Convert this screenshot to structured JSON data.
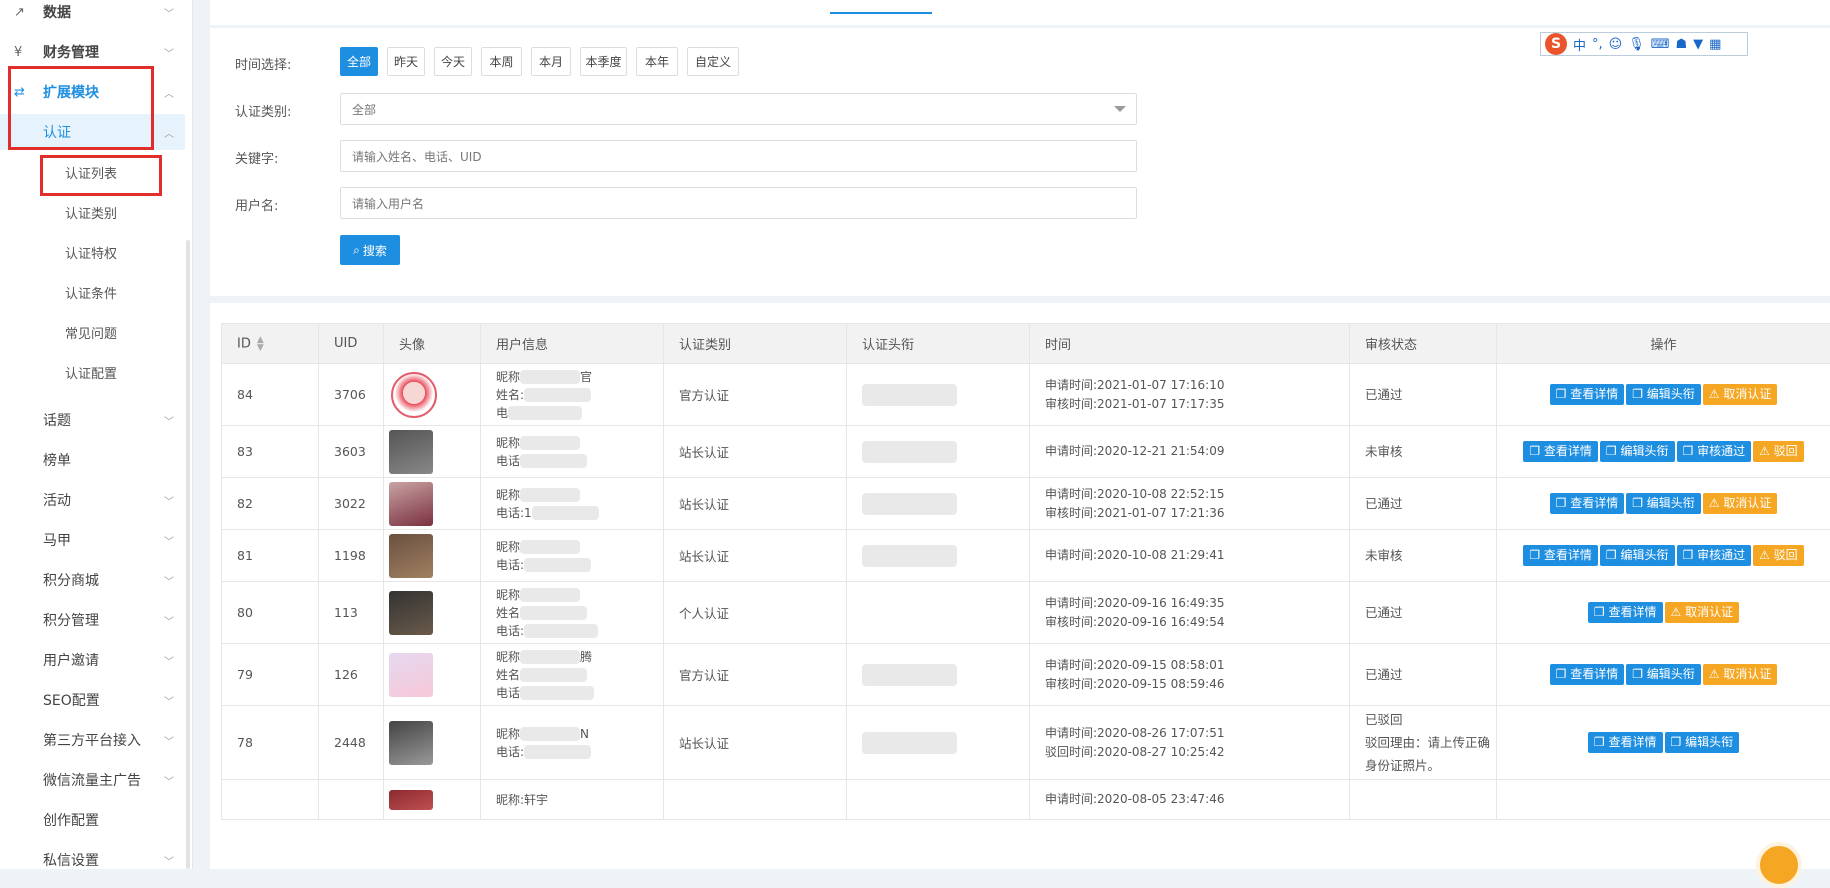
{
  "sidebar": {
    "items": [
      {
        "label": "数据",
        "icon": "line-chart-icon",
        "kind": "top-lvl",
        "chevron": true
      },
      {
        "label": "财务管理",
        "icon": "finance-icon",
        "kind": "top-lvl",
        "chevron": true
      },
      {
        "label": "扩展模块",
        "icon": "extend-icon",
        "kind": "top-lvl active",
        "chevron": true
      },
      {
        "label": "认证",
        "kind": "sub selected",
        "chevron": true
      },
      {
        "label": "认证列表",
        "kind": "leaf"
      },
      {
        "label": "认证类别",
        "kind": "leaf"
      },
      {
        "label": "认证特权",
        "kind": "leaf"
      },
      {
        "label": "认证条件",
        "kind": "leaf"
      },
      {
        "label": "常见问题",
        "kind": "leaf"
      },
      {
        "label": "认证配置",
        "kind": "leaf"
      },
      {
        "label": "话题",
        "kind": "plain",
        "chevron": true
      },
      {
        "label": "榜单",
        "kind": "plain"
      },
      {
        "label": "活动",
        "kind": "plain",
        "chevron": true
      },
      {
        "label": "马甲",
        "kind": "plain",
        "chevron": true
      },
      {
        "label": "积分商城",
        "kind": "plain",
        "chevron": true
      },
      {
        "label": "积分管理",
        "kind": "plain",
        "chevron": true
      },
      {
        "label": "用户邀请",
        "kind": "plain",
        "chevron": true
      },
      {
        "label": "SEO配置",
        "kind": "plain",
        "chevron": true
      },
      {
        "label": "第三方平台接入",
        "kind": "plain",
        "chevron": true
      },
      {
        "label": "微信流量主广告",
        "kind": "plain",
        "chevron": true
      },
      {
        "label": "创作配置",
        "kind": "plain"
      },
      {
        "label": "私信设置",
        "kind": "plain",
        "chevron": true
      }
    ]
  },
  "filters": {
    "time_label": "时间选择:",
    "time_buttons": [
      "全部",
      "昨天",
      "今天",
      "本周",
      "本月",
      "本季度",
      "本年",
      "自定义"
    ],
    "type_label": "认证类别:",
    "type_value": "全部",
    "keyword_label": "关键字:",
    "keyword_placeholder": "请输入姓名、电话、UID",
    "username_label": "用户名:",
    "username_placeholder": "请输入用户名",
    "search_label": "搜索"
  },
  "ime": {
    "logo": "S",
    "lang": "中",
    "symbols": "°,"
  },
  "table": {
    "headers": [
      "ID",
      "UID",
      "头像",
      "用户信息",
      "认证类别",
      "认证头衔",
      "时间",
      "审核状态",
      "操作"
    ],
    "rows": [
      {
        "id": "84",
        "uid": "3706",
        "info": [
          "昵称",
          "姓名:",
          "电"
        ],
        "info_tail": "官",
        "type": "官方认证",
        "times": [
          "申请时间:2021-01-07 17:16:10",
          "审核时间:2021-01-07 17:17:35"
        ],
        "status": [
          "已通过"
        ],
        "ops": [
          "查看详情",
          "编辑头衔",
          "取消认证"
        ]
      },
      {
        "id": "83",
        "uid": "3603",
        "info": [
          "昵称",
          "电话"
        ],
        "type": "站长认证",
        "times": [
          "申请时间:2020-12-21 21:54:09"
        ],
        "status": [
          "未审核"
        ],
        "ops": [
          "查看详情",
          "编辑头衔",
          "审核通过",
          "驳回"
        ]
      },
      {
        "id": "82",
        "uid": "3022",
        "info": [
          "昵称",
          "电话:1"
        ],
        "type": "站长认证",
        "times": [
          "申请时间:2020-10-08 22:52:15",
          "审核时间:2021-01-07 17:21:36"
        ],
        "status": [
          "已通过"
        ],
        "ops": [
          "查看详情",
          "编辑头衔",
          "取消认证"
        ]
      },
      {
        "id": "81",
        "uid": "1198",
        "info": [
          "昵称",
          "电话:"
        ],
        "type": "站长认证",
        "times": [
          "申请时间:2020-10-08 21:29:41"
        ],
        "status": [
          "未审核"
        ],
        "ops": [
          "查看详情",
          "编辑头衔",
          "审核通过",
          "驳回"
        ]
      },
      {
        "id": "80",
        "uid": "113",
        "info": [
          "昵称",
          "姓名",
          "电话:"
        ],
        "type": "个人认证",
        "times": [
          "申请时间:2020-09-16 16:49:35",
          "审核时间:2020-09-16 16:49:54"
        ],
        "status": [
          "已通过"
        ],
        "ops": [
          "查看详情",
          "取消认证"
        ]
      },
      {
        "id": "79",
        "uid": "126",
        "info": [
          "昵称",
          "姓名",
          "电话"
        ],
        "info_tail": "腾",
        "type": "官方认证",
        "times": [
          "申请时间:2020-09-15 08:58:01",
          "审核时间:2020-09-15 08:59:46"
        ],
        "status": [
          "已通过"
        ],
        "ops": [
          "查看详情",
          "编辑头衔",
          "取消认证"
        ]
      },
      {
        "id": "78",
        "uid": "2448",
        "info": [
          "昵称",
          "电话:"
        ],
        "info_tail": "N",
        "type": "站长认证",
        "times": [
          "申请时间:2020-08-26 17:07:51",
          "驳回时间:2020-08-27 10:25:42"
        ],
        "status": [
          "已驳回",
          "驳回理由：请上传正确",
          "身份证照片。"
        ],
        "ops": [
          "查看详情",
          "编辑头衔"
        ]
      },
      {
        "id": "",
        "uid": "",
        "info": [
          "昵称:轩宇"
        ],
        "type": "",
        "times": [
          "申请时间:2020-08-05 23:47:46"
        ],
        "status": [
          ""
        ],
        "ops": []
      }
    ]
  },
  "colors": {
    "accent": "#1e8ee0",
    "warn": "#f5a623",
    "highlight": "#e22d2d"
  }
}
